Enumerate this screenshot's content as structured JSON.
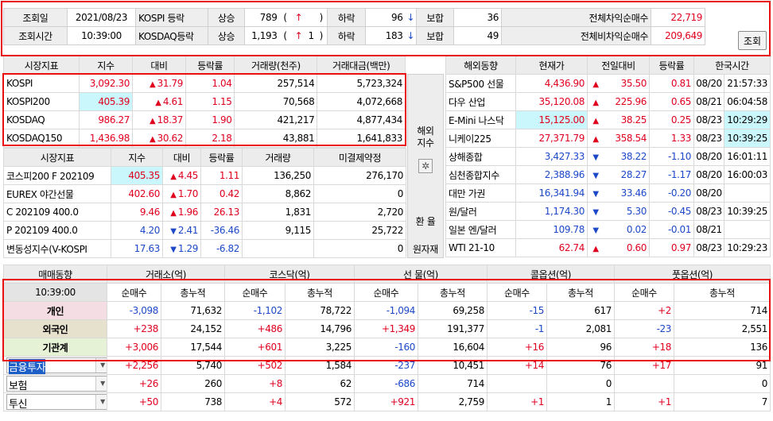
{
  "top": {
    "date_label": "조회일",
    "date": "2021/08/23",
    "time_label": "조회시간",
    "time": "10:39:00",
    "kospi_label": "KOSPI 등락",
    "kosdaq_label": "KOSDAQ등락",
    "up_label": "상승",
    "down_label": "하락",
    "flat_label": "보합",
    "kospi_up": "789",
    "kospi_up_limit": "",
    "kospi_down": "96",
    "kospi_flat": "36",
    "kosdaq_up": "1,193",
    "kosdaq_up_limit": "1",
    "kosdaq_down": "183",
    "kosdaq_flat": "49",
    "paren_open": "(",
    "paren_close": ")",
    "arb_label": "전체차익순매수",
    "arb_value": "22,719",
    "nonarb_label": "전체비차익순매수",
    "nonarb_value": "209,649",
    "search_button": "조회"
  },
  "market": {
    "headers": [
      "시장지표",
      "지수",
      "대비",
      "등락률",
      "거래량(천주)",
      "거래대금(백만)"
    ],
    "rows": [
      {
        "name": "KOSPI",
        "index": "3,092.30",
        "dir": "up",
        "change": "31.79",
        "rate": "1.04",
        "volume": "257,514",
        "amount": "5,723,324"
      },
      {
        "name": "KOSPI200",
        "index": "405.39",
        "dir": "up",
        "change": "4.61",
        "rate": "1.15",
        "volume": "70,568",
        "amount": "4,072,668"
      },
      {
        "name": "KOSDAQ",
        "index": "986.27",
        "dir": "up",
        "change": "18.37",
        "rate": "1.90",
        "volume": "421,217",
        "amount": "4,877,434"
      },
      {
        "name": "KOSDAQ150",
        "index": "1,436.98",
        "dir": "up",
        "change": "30.62",
        "rate": "2.18",
        "volume": "43,881",
        "amount": "1,641,833"
      }
    ]
  },
  "futures": {
    "headers": [
      "시장지표",
      "지수",
      "대비",
      "등락률",
      "거래량",
      "미결제약정"
    ],
    "rows": [
      {
        "name": "코스피200 F 202109",
        "index": "405.35",
        "dir": "up",
        "change": "4.45",
        "rate": "1.11",
        "volume": "136,250",
        "oi": "276,170"
      },
      {
        "name": "EUREX 야간선물",
        "index": "402.60",
        "dir": "up",
        "change": "1.70",
        "rate": "0.42",
        "volume": "8,862",
        "oi": "0"
      },
      {
        "name": "C 202109 400.0",
        "index": "9.46",
        "dir": "up",
        "change": "1.96",
        "rate": "26.13",
        "volume": "1,831",
        "oi": "2,720"
      },
      {
        "name": "P 202109 400.0",
        "index": "4.20",
        "dir": "down",
        "change": "2.41",
        "rate": "-36.46",
        "volume": "9,115",
        "oi": "25,722"
      },
      {
        "name": "변동성지수(V-KOSPI",
        "index": "17.63",
        "dir": "down",
        "change": "1.29",
        "rate": "-6.82",
        "volume": "",
        "oi": "0"
      }
    ]
  },
  "side": {
    "overseas_label_1": "해외",
    "overseas_label_2": "지수",
    "fx_label": "환 율",
    "raw_label": "원자재"
  },
  "overseas": {
    "headers": [
      "해외동향",
      "현재가",
      "전일대비",
      "등락률",
      "한국시간"
    ],
    "rows": [
      {
        "name": "S&P500 선물",
        "price": "4,436.90",
        "dir": "up",
        "change": "35.50",
        "rate": "0.81",
        "date": "08/20",
        "time": "21:57:33"
      },
      {
        "name": "다우 산업",
        "price": "35,120.08",
        "dir": "up",
        "change": "225.96",
        "rate": "0.65",
        "date": "08/21",
        "time": "06:04:58"
      },
      {
        "name": "E-Mini 나스닥",
        "price": "15,125.00",
        "dir": "up",
        "change": "38.25",
        "rate": "0.25",
        "date": "08/23",
        "time": "10:29:29"
      },
      {
        "name": "니케이225",
        "price": "27,371.79",
        "dir": "up",
        "change": "358.54",
        "rate": "1.33",
        "date": "08/23",
        "time": "10:39:25"
      },
      {
        "name": "상해종합",
        "price": "3,427.33",
        "dir": "down",
        "change": "38.22",
        "rate": "-1.10",
        "date": "08/20",
        "time": "16:01:11"
      },
      {
        "name": "심천종합지수",
        "price": "2,388.96",
        "dir": "down",
        "change": "28.27",
        "rate": "-1.17",
        "date": "08/20",
        "time": "16:00:03"
      },
      {
        "name": "대만 가권",
        "price": "16,341.94",
        "dir": "down",
        "change": "33.46",
        "rate": "-0.20",
        "date": "08/20",
        "time": ""
      },
      {
        "name": "원/달러",
        "price": "1,174.30",
        "dir": "down",
        "change": "5.30",
        "rate": "-0.45",
        "date": "08/23",
        "time": "10:39:25"
      },
      {
        "name": "일본 엔/달러",
        "price": "109.78",
        "dir": "down",
        "change": "0.02",
        "rate": "-0.01",
        "date": "08/21",
        "time": ""
      },
      {
        "name": "WTI 21-10",
        "price": "62.74",
        "dir": "up",
        "change": "0.60",
        "rate": "0.97",
        "date": "08/23",
        "time": "10:29:23"
      }
    ]
  },
  "investor": {
    "section_headers": [
      "매매동향",
      "거래소(억)",
      "코스닥(억)",
      "선 물(억)",
      "콜옵션(억)",
      "풋옵션(억)"
    ],
    "time": "10:39:00",
    "sub_net": "순매수",
    "sub_cum": "총누적",
    "rows": [
      {
        "name": "개인",
        "v": [
          "-3,098",
          "71,632",
          "-1,102",
          "78,722",
          "-1,094",
          "69,258",
          "-15",
          "617",
          "+2",
          "714"
        ]
      },
      {
        "name": "외국인",
        "v": [
          "+238",
          "24,152",
          "+486",
          "14,796",
          "+1,349",
          "191,377",
          "-1",
          "2,081",
          "-23",
          "2,551"
        ]
      },
      {
        "name": "기관계",
        "v": [
          "+3,006",
          "17,544",
          "+601",
          "3,225",
          "-160",
          "16,604",
          "+16",
          "96",
          "+18",
          "136"
        ]
      }
    ],
    "extra_rows": [
      {
        "name": "금융투자",
        "v": [
          "+2,256",
          "5,740",
          "+502",
          "1,584",
          "-237",
          "10,451",
          "+14",
          "76",
          "+17",
          "91"
        ]
      },
      {
        "name": "보험",
        "v": [
          "+26",
          "260",
          "+8",
          "62",
          "-686",
          "714",
          "",
          "0",
          "",
          "0"
        ]
      },
      {
        "name": "투신",
        "v": [
          "+50",
          "738",
          "+4",
          "572",
          "+921",
          "2,759",
          "+1",
          "1",
          "+1",
          "7"
        ]
      }
    ]
  },
  "icons": {
    "up": "▲",
    "down": "▼",
    "up_arrow": "↑",
    "down_arrow": "↓",
    "dropdown": "▼"
  },
  "colors": {
    "up": "#e0001e",
    "down": "#1d48c8",
    "highlight_box": "#e81010",
    "cyan_cell": "#c9f7fb"
  }
}
